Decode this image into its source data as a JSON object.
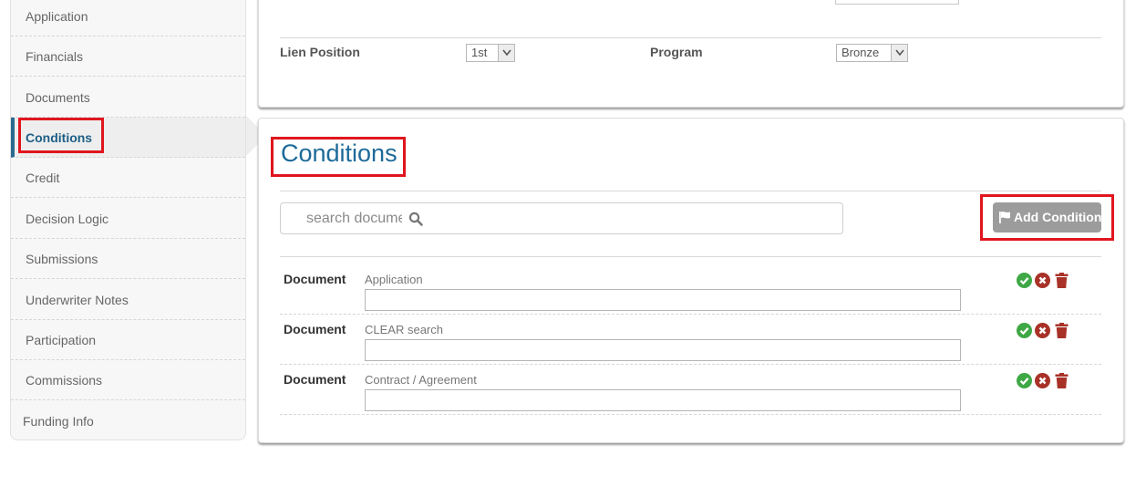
{
  "sidebar": {
    "items": [
      {
        "label": "Application"
      },
      {
        "label": "Financials"
      },
      {
        "label": "Documents"
      },
      {
        "label": "Conditions",
        "active": true
      },
      {
        "label": "Credit"
      },
      {
        "label": "Decision Logic"
      },
      {
        "label": "Submissions"
      },
      {
        "label": "Underwriter Notes"
      },
      {
        "label": "Participation"
      },
      {
        "label": "Commissions"
      },
      {
        "label": "Funding Info"
      }
    ]
  },
  "top_panel": {
    "lien_position_label": "Lien Position",
    "lien_position_value": "1st",
    "program_label": "Program",
    "program_value": "Bronze"
  },
  "conditions": {
    "title": "Conditions",
    "search_placeholder": "search docume",
    "add_button_label": "Add Condition",
    "rows": [
      {
        "type": "Document",
        "name": "Application",
        "note": ""
      },
      {
        "type": "Document",
        "name": "CLEAR search",
        "note": ""
      },
      {
        "type": "Document",
        "name": "Contract / Agreement",
        "note": ""
      }
    ]
  },
  "colors": {
    "accent": "#1d6a99",
    "highlight": "#e0161e",
    "approve": "#3fa846",
    "reject": "#a83228",
    "delete": "#a83228",
    "button_gray": "#9c9c9c"
  },
  "icons": {
    "add_button": "flag-icon",
    "search": "search-icon",
    "approve": "check-circle-icon",
    "reject": "x-circle-icon",
    "delete": "trash-icon"
  }
}
